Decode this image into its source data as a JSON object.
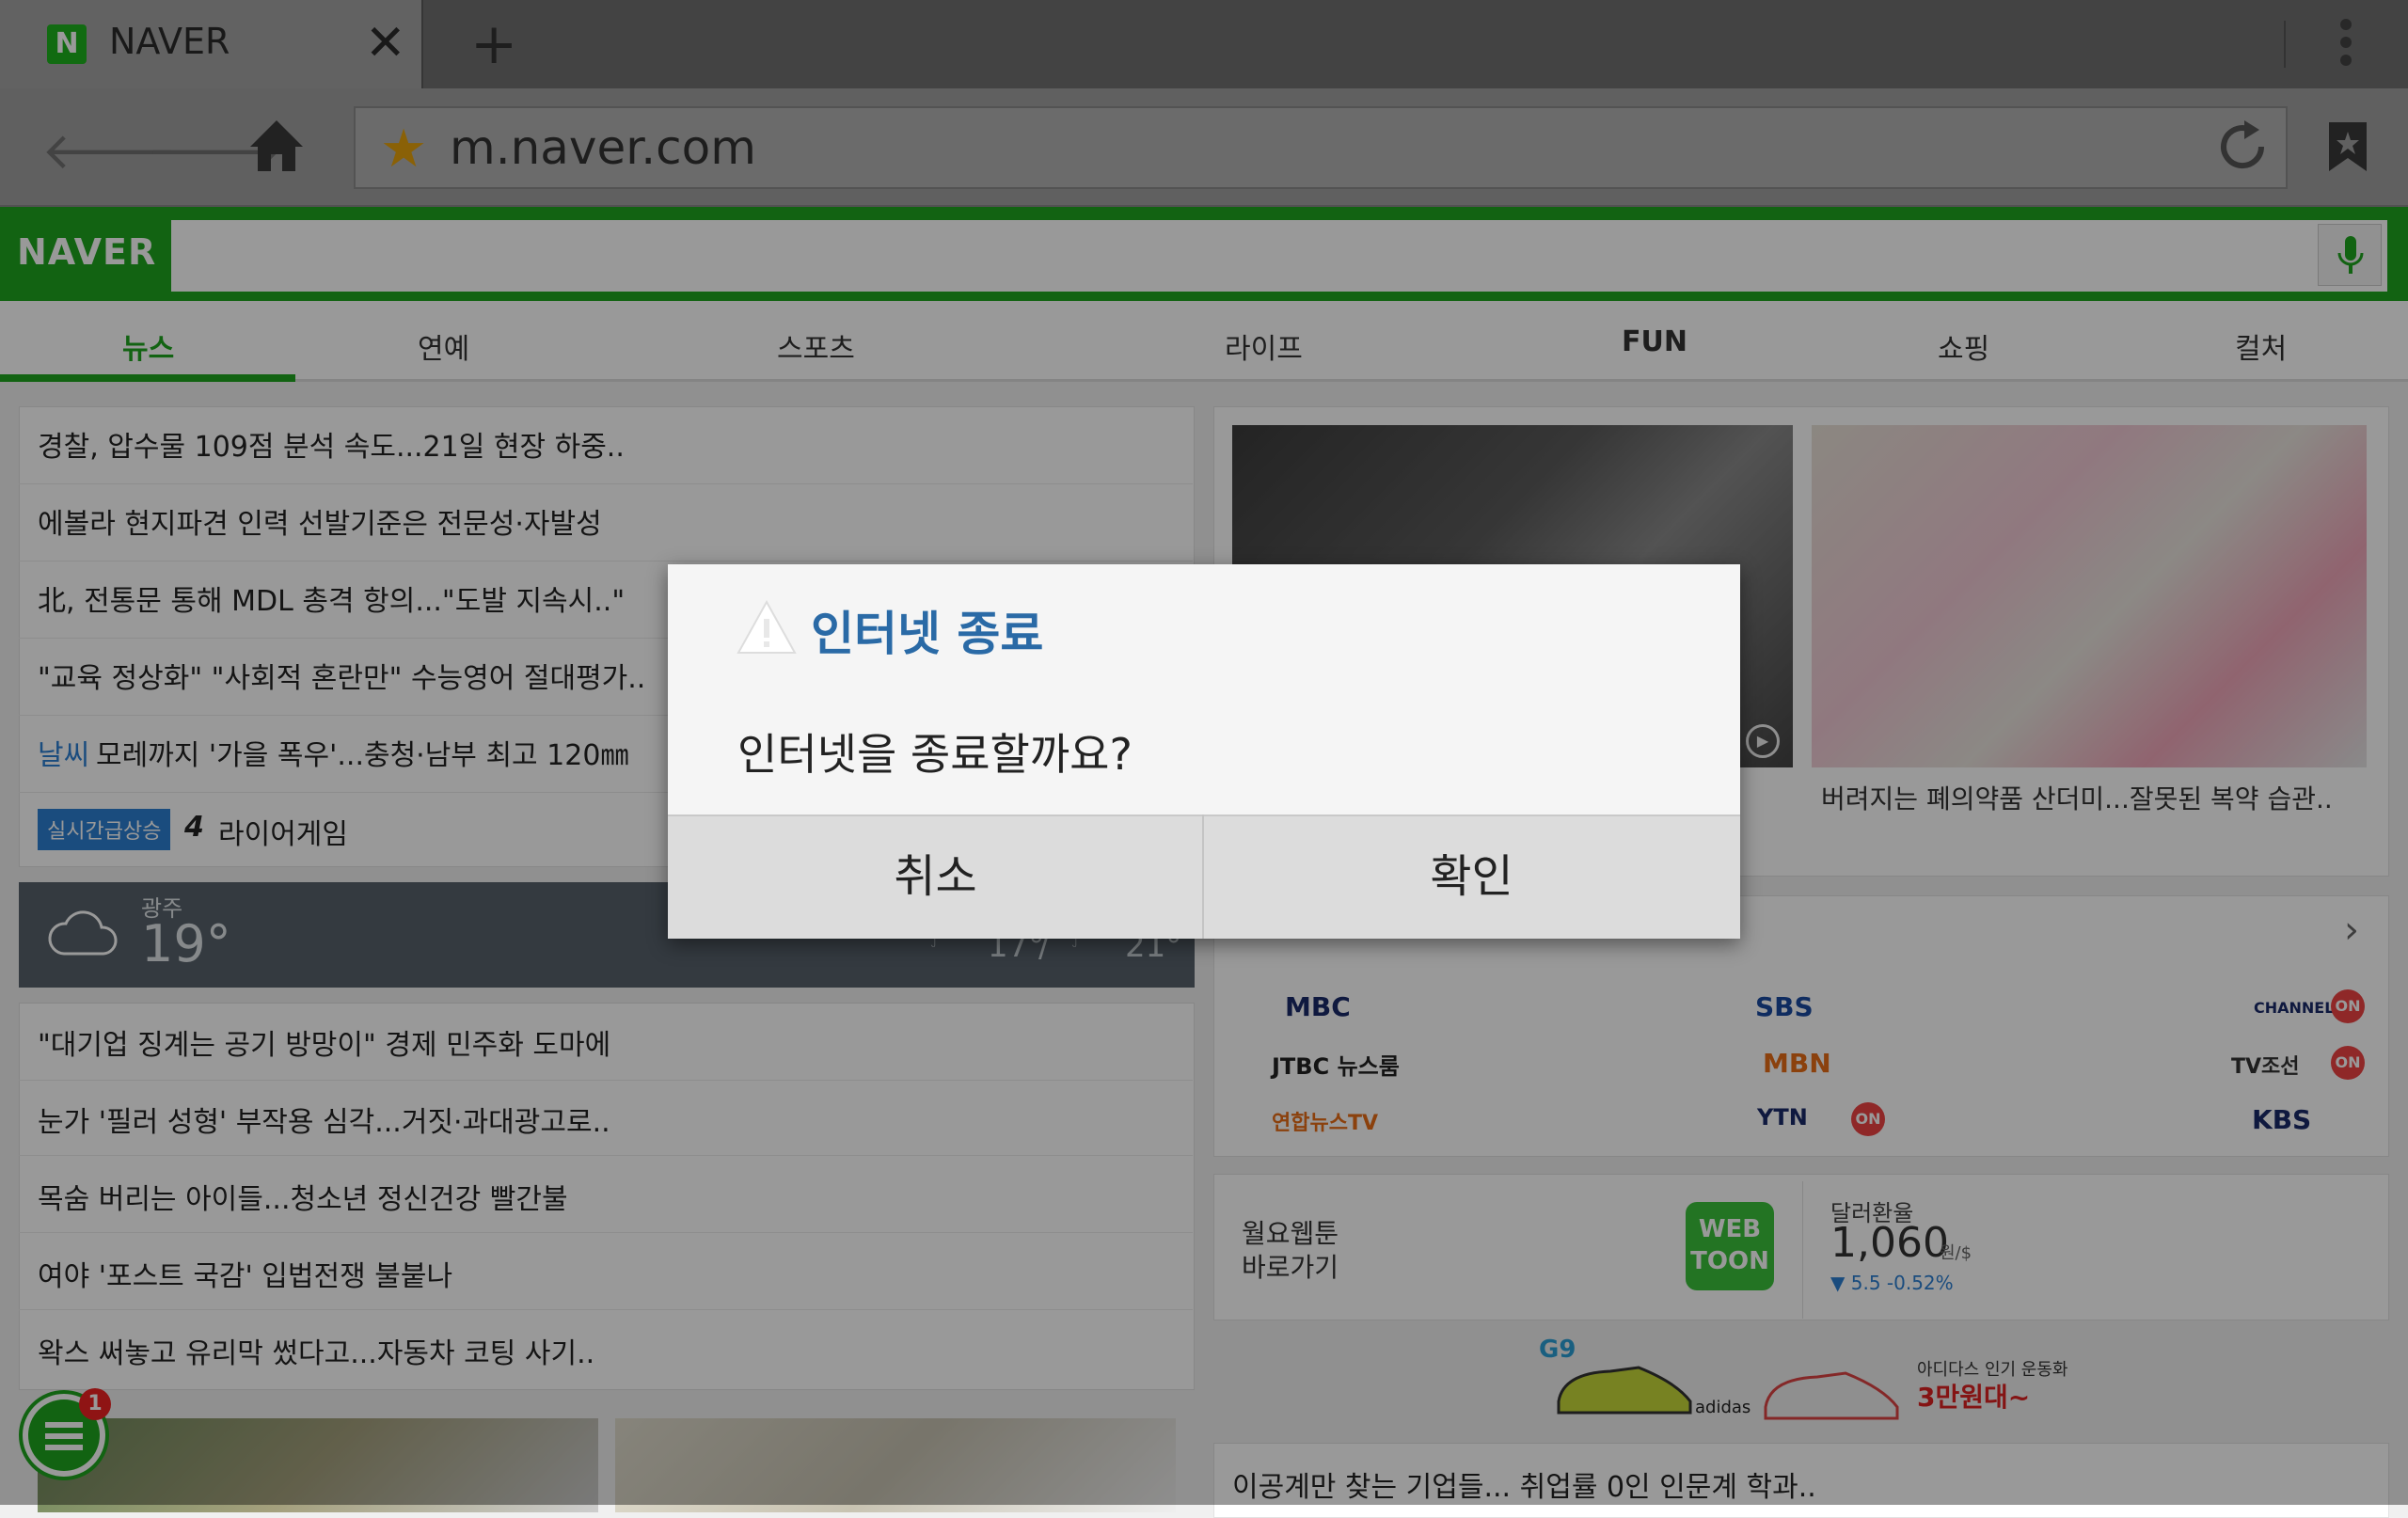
{
  "browser": {
    "tab_favicon": "N",
    "tab_title": "NAVER",
    "tab_close": "✕",
    "new_tab": "+",
    "url": "m.naver.com"
  },
  "naver": {
    "logo": "NAVER",
    "search_placeholder": "",
    "categories": [
      "뉴스",
      "연예",
      "스포츠",
      "라이프",
      "FUN",
      "쇼핑",
      "컬처"
    ],
    "active_category": "뉴스"
  },
  "news_top": [
    "경찰, 압수물 109점 분석 속도...21일 현장 하중..",
    "에볼라 현지파견 인력 선발기준은 전문성·자발성",
    "北, 전통문 통해 MDL 총격 항의...\"도발 지속시..\"",
    "\"교육 정상화\" \"사회적 혼란만\" 수능영어 절대평가..",
    "모레까지 '가을 폭우'...충청·남부 최고 120㎜"
  ],
  "weather_tag": "날씨",
  "realtime": {
    "badge": "실시간급상승",
    "rank": "4",
    "keyword": "라이어게임"
  },
  "weather": {
    "city": "광주",
    "temp": "19°",
    "low": "17°",
    "high": "21°",
    "sep": "/"
  },
  "news_bottom": [
    "\"대기업 징계는 공기 방망이\" 경제 민주화 도마에",
    "눈가 '필러 성형' 부작용 심각...거짓·과대광고로..",
    "목숨 버리는 아이들...청소년 정신건강 빨간불",
    "여야 '포스트 국감' 입법전쟁 불붙나",
    "왁스 써놓고 유리막 썼다고...자동차 코팅 사기.."
  ],
  "photo_caption": "버려지는 폐의약품 산더미...잘못된 복약 습관..",
  "broadcasters": [
    "MBC",
    "SBS",
    "CHANNEL A",
    "JTBC 뉴스룸",
    "MBN",
    "TV조선",
    "연합뉴스TV",
    "YTN",
    "KBS"
  ],
  "on_label": "ON",
  "webtoon": {
    "line1": "월요웹툰",
    "line2": "바로가기",
    "logo": "WEB TOON"
  },
  "exchange": {
    "label": "달러환율",
    "value": "1,060",
    "unit": "원/$",
    "change": "▼ 5.5 -0.52%"
  },
  "ad": {
    "brand": "G9",
    "maker": "adidas",
    "line1": "아디다스 인기 운동화",
    "line2": "3만원대~"
  },
  "bottom_headline": "이공계만 찾는 기업들... 취업률 0인 인문계 학과..",
  "fab_badge": "1",
  "dialog": {
    "title": "인터넷 종료",
    "message": "인터넷을 종료할까요?",
    "cancel": "취소",
    "confirm": "확인"
  },
  "colors": {
    "naver_green": "#1ea51e",
    "dialog_title": "#2a6aa6",
    "tag_blue": "#2c7fd2"
  }
}
